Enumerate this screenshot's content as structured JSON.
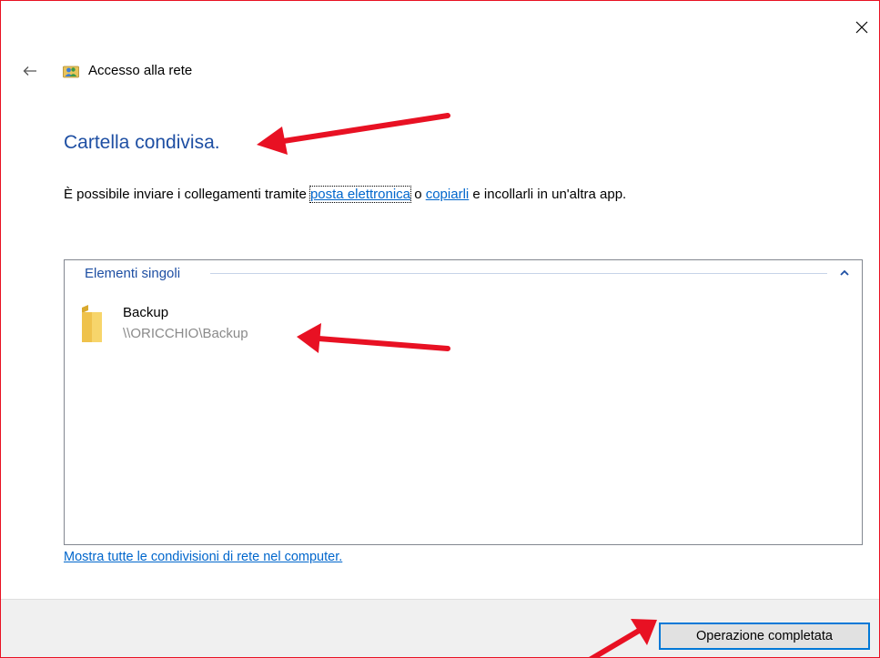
{
  "window": {
    "title": "Accesso alla rete",
    "close_icon": "close-icon",
    "back_icon": "back-arrow-icon",
    "title_icon": "network-users-icon"
  },
  "heading": "Cartella condivisa.",
  "description": {
    "prefix": "È possibile inviare i collegamenti tramite ",
    "email_link": "posta elettronica",
    "middle": " o ",
    "copy_link": "copiarli",
    "suffix": " e incollarli in un'altra app."
  },
  "items_group": {
    "label": "Elementi singoli",
    "toggle_icon": "chevron-up-icon",
    "items": [
      {
        "icon": "folder-icon",
        "name": "Backup",
        "path": "\\\\ORICCHIO\\Backup"
      }
    ]
  },
  "show_all_link": "Mostra tutte le condivisioni di rete nel computer.",
  "footer": {
    "done_label": "Operazione completata"
  },
  "colors": {
    "heading": "#1e4fa3",
    "link": "#0066cc",
    "annotation_arrow": "#e81123",
    "window_border": "#e81123",
    "button_focus": "#0078d7"
  }
}
